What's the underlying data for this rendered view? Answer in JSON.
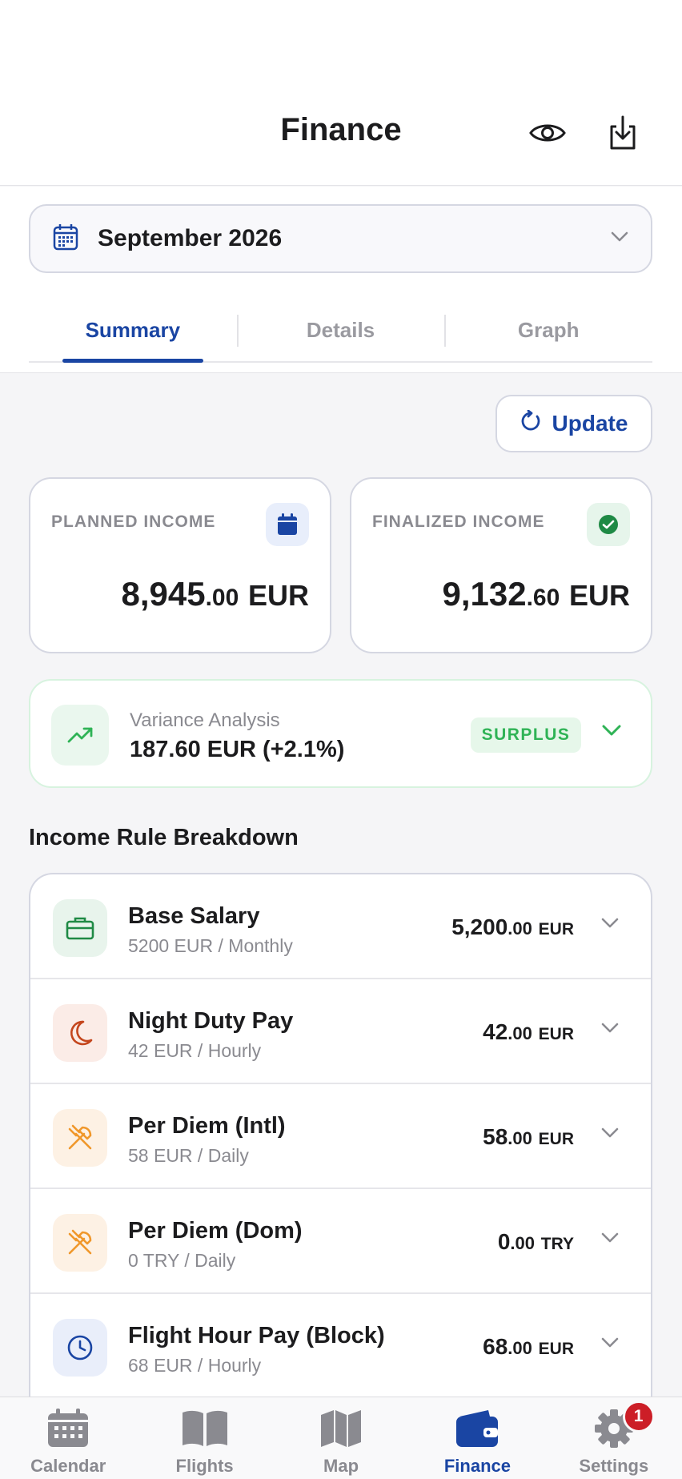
{
  "header": {
    "title": "Finance"
  },
  "month_selector": {
    "value": "September 2026"
  },
  "tabs": [
    {
      "label": "Summary",
      "active": true
    },
    {
      "label": "Details",
      "active": false
    },
    {
      "label": "Graph",
      "active": false
    }
  ],
  "update_button": {
    "label": "Update"
  },
  "planned_income": {
    "caption": "PLANNED INCOME",
    "whole": "8,945",
    "decimal": ".00",
    "currency": "EUR"
  },
  "finalized_income": {
    "caption": "FINALIZED INCOME",
    "whole": "9,132",
    "decimal": ".60",
    "currency": "EUR"
  },
  "variance": {
    "label": "Variance Analysis",
    "value": "187.60 EUR (+2.1%)",
    "tag": "SURPLUS"
  },
  "income_rules": {
    "title": "Income Rule Breakdown",
    "items": [
      {
        "name": "Base Salary",
        "sub": "5200 EUR / Monthly",
        "whole": "5,200",
        "decimal": ".00",
        "currency": "EUR",
        "icon": "briefcase-icon"
      },
      {
        "name": "Night Duty Pay",
        "sub": "42 EUR / Hourly",
        "whole": "42",
        "decimal": ".00",
        "currency": "EUR",
        "icon": "moon-icon"
      },
      {
        "name": "Per Diem (Intl)",
        "sub": "58 EUR / Daily",
        "whole": "58",
        "decimal": ".00",
        "currency": "EUR",
        "icon": "utensils-icon"
      },
      {
        "name": "Per Diem (Dom)",
        "sub": "0 TRY / Daily",
        "whole": "0",
        "decimal": ".00",
        "currency": "TRY",
        "icon": "utensils-icon"
      },
      {
        "name": "Flight Hour Pay (Block)",
        "sub": "68 EUR / Hourly",
        "whole": "68",
        "decimal": ".00",
        "currency": "EUR",
        "icon": "clock-icon"
      }
    ]
  },
  "bottom_nav": {
    "items": [
      {
        "label": "Calendar",
        "icon": "calendar-icon"
      },
      {
        "label": "Flights",
        "icon": "book-icon"
      },
      {
        "label": "Map",
        "icon": "map-icon"
      },
      {
        "label": "Finance",
        "icon": "wallet-icon",
        "active": true
      },
      {
        "label": "Settings",
        "icon": "gear-icon",
        "badge": "1"
      }
    ]
  },
  "colors": {
    "accent": "#1a45a3",
    "success": "#2fb356",
    "badge": "#cc1e27"
  }
}
